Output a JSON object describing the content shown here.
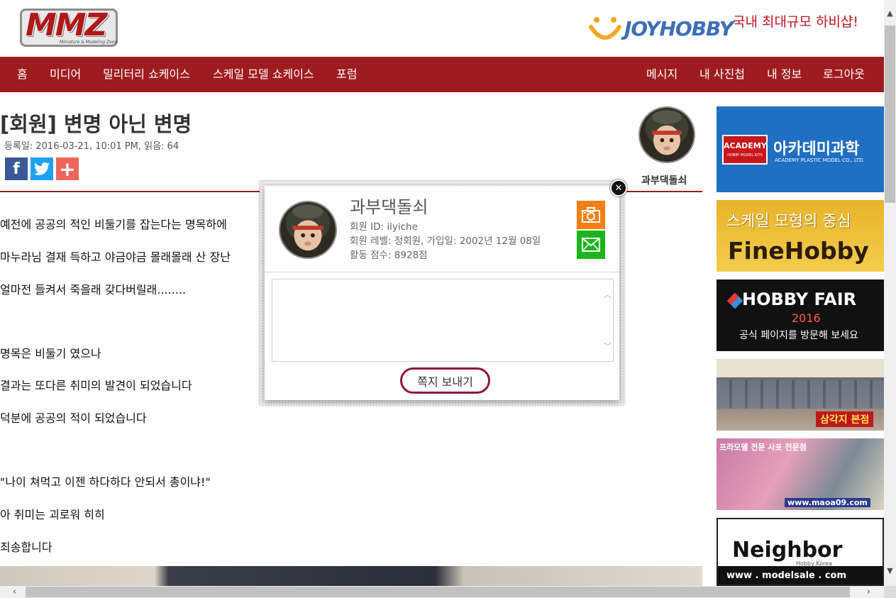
{
  "header": {
    "logo_text": "MMZ",
    "logo_sub": "Miniature & Modeling Zone",
    "ad_brand": "JOYHOBBY",
    "ad_tagline": "국내 최대규모 하비샵!"
  },
  "nav": {
    "left": [
      "홈",
      "미디어",
      "밀리터리 쇼케이스",
      "스케일 모델 쇼케이스",
      "포럼"
    ],
    "right": [
      "메시지",
      "내 사진첩",
      "내 정보",
      "로그아웃"
    ]
  },
  "post": {
    "title": "[회원] 변명 아닌 변명",
    "meta": "등록일: 2016-03-21, 10:01 PM, 읽음: 64",
    "author": "과부댁돌쇠",
    "paragraphs": [
      "예전에 공공의 적인 비둘기를 잡는다는 명목하에",
      "마누라님 결재 득하고 야금야금 몰래몰래 산 장난",
      "얼마전 들켜서 죽을래 갖다버릴래........",
      "명목은 비둘기 였으나",
      "결과는 또다른 취미의 발견이 되었습니다",
      "덕분에 공공의 적이 되었습니다",
      "\"나이 쳐먹고 이젠 하다하다 안되서 총이냐!\"",
      "아 취미는 괴로워 히히",
      "죄송합니다"
    ]
  },
  "share": {
    "facebook": "f",
    "twitter": "twitter-icon",
    "more": "+"
  },
  "popup": {
    "name": "과부댁돌쇠",
    "member_id": "회원 ID: ilyiche",
    "level": "회원 레벨: 정회원, 가입일: 2002년 12월 08일",
    "points": "활동 점수: 8928점",
    "textarea_value": "",
    "send_label": "쪽지 보내기"
  },
  "ads": {
    "academy_logo": "ACADEMY",
    "academy_logo_sub": "HOBBY MODEL KITS",
    "academy_name": "아카데미과학",
    "academy_sub": "ACADEMY PLASTIC MODEL CO., LTD.",
    "finehobby_top": "스케일 모형의 중심",
    "finehobby_name": "FineHobby",
    "hobbyfair_name": "HOBBY FAIR",
    "hobbyfair_year": "2016",
    "hobbyfair_sub": "공식 페이지를 방문해 보세요",
    "store_sign": "삼각지 본점",
    "maoa_top": "프라모델 전문 사포 전문점",
    "maoa_url": "www.maoa09.com",
    "neighbor_name": "Neighbor",
    "neighbor_sub": "Hobby Korea",
    "neighbor_url": "www . modelsale . com"
  },
  "colors": {
    "nav_bg": "#9e1c1f",
    "accent_red": "#c1121f",
    "camera_button": "#f57f11",
    "mail_button": "#1bb51b",
    "send_border": "#8c1a3b"
  }
}
